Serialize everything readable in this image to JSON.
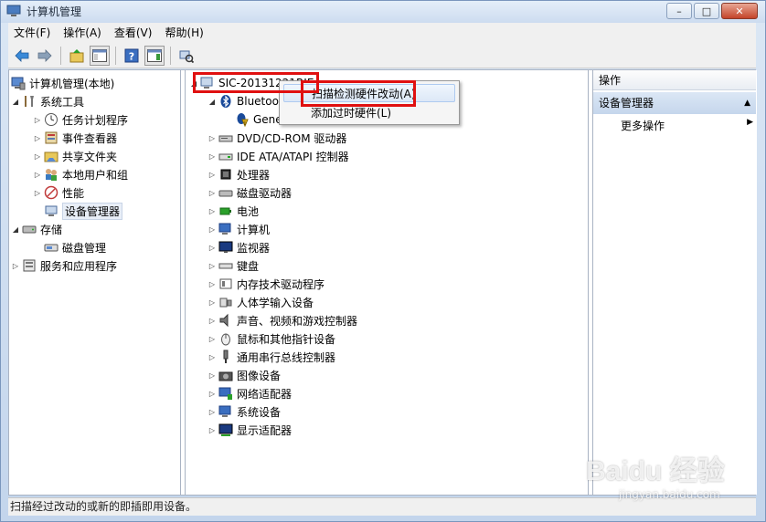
{
  "window": {
    "title": "计算机管理"
  },
  "menubar": {
    "items": [
      "文件(F)",
      "操作(A)",
      "查看(V)",
      "帮助(H)"
    ]
  },
  "left_tree": {
    "root": "计算机管理(本地)",
    "system_tools": "系统工具",
    "task_scheduler": "任务计划程序",
    "event_viewer": "事件查看器",
    "shared_folders": "共享文件夹",
    "local_users": "本地用户和组",
    "performance": "性能",
    "device_manager": "设备管理器",
    "storage": "存储",
    "disk_mgmt": "磁盘管理",
    "services_apps": "服务和应用程序"
  },
  "device_tree": {
    "computer_name": "SIC-20131221RIE",
    "bluetooth": "Bluetooth",
    "bluetooth_child": "Generic Bluetooth",
    "categories": [
      "DVD/CD-ROM 驱动器",
      "IDE ATA/ATAPI 控制器",
      "处理器",
      "磁盘驱动器",
      "电池",
      "计算机",
      "监视器",
      "键盘",
      "内存技术驱动程序",
      "人体学输入设备",
      "声音、视频和游戏控制器",
      "鼠标和其他指针设备",
      "通用串行总线控制器",
      "图像设备",
      "网络适配器",
      "系统设备",
      "显示适配器"
    ]
  },
  "context_menu": {
    "scan": "扫描检测硬件改动(A)",
    "add_legacy": "添加过时硬件(L)"
  },
  "actions": {
    "header": "操作",
    "section": "设备管理器",
    "more": "更多操作"
  },
  "status": {
    "text": "扫描经过改动的或新的即插即用设备。"
  },
  "watermark": {
    "logo": "Baidu 经验",
    "url": "jingyan.baidu.com"
  }
}
